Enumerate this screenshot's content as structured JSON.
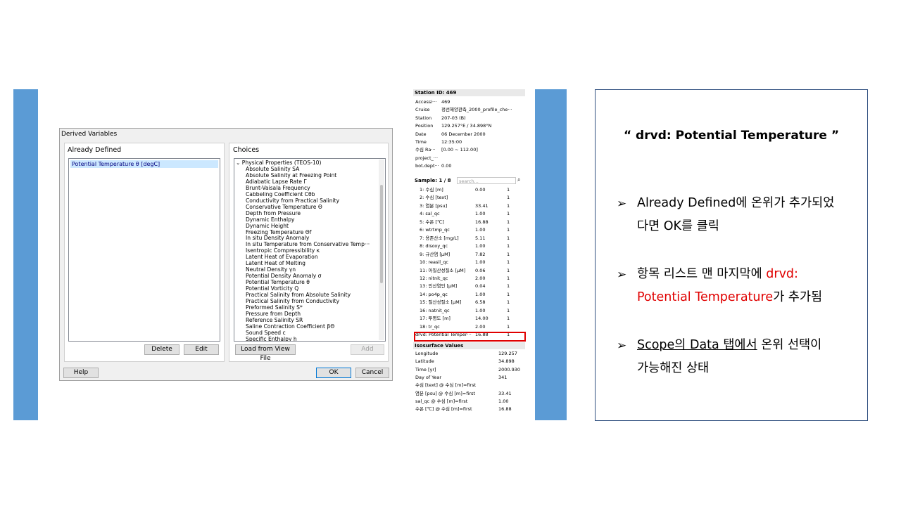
{
  "dialog": {
    "title": "Derived Variables",
    "already_defined_label": "Already Defined",
    "choices_label": "Choices",
    "defined_item": "Potential Temperature θ [degC]",
    "tree_root": "Physical Properties (TEOS-10)",
    "choices": [
      "Absolute Salinity SA",
      "Absolute Salinity at Freezing Point",
      "Adiabatic Lapse Rate Γ",
      "Brunt-Vaisala Frequency",
      "Cabbeling Coefficient Cθb",
      "Conductivity from Practical Salinity",
      "Conservative Temperature Θ",
      "Depth from Pressure",
      "Dynamic Enthalpy",
      "Dynamic Height",
      "Freezing Temperature Θf",
      "In situ Density Anomaly",
      "In situ Temperature from Conservative Temp···",
      "Isentropic Compressibility κ",
      "Latent Heat of Evaporation",
      "Latent Heat of Melting",
      "Neutral Density γn",
      "Potential Density Anomaly σ",
      "Potential Temperature θ",
      "Potential Vorticity Q",
      "Practical Salinity from Absolute Salinity",
      "Practical Salinity from Conductivity",
      "Preformed Salinity S*",
      "Pressure from Depth",
      "Reference Salinity SR",
      "Saline Contraction Coefficient βΘ",
      "Sound Speed c",
      "Specific Enthalpy h"
    ],
    "buttons": {
      "delete": "Delete",
      "edit": "Edit",
      "load": "Load from View File",
      "add": "Add",
      "help": "Help",
      "ok": "OK",
      "cancel": "Cancel"
    }
  },
  "station": {
    "header": "Station ID: 469",
    "rows": [
      {
        "k": "Accessi···",
        "v": "469"
      },
      {
        "k": "Cruise",
        "v": "정선해양관측_2000_profile_che···"
      },
      {
        "k": "Station",
        "v": "207-03 (B)"
      },
      {
        "k": "Position",
        "v": "129.257°E / 34.898°N"
      },
      {
        "k": "Date",
        "v": "06 December 2000"
      },
      {
        "k": "Time",
        "v": "12:35:00"
      },
      {
        "k": "수심 Ra···",
        "v": "[0.00 ~ 112.00]"
      },
      {
        "k": "project_···",
        "v": ""
      },
      {
        "k": "bot.dept···",
        "v": "0.00"
      }
    ]
  },
  "sample": {
    "header": "Sample: 1 / 8",
    "search_placeholder": "search...",
    "rows": [
      {
        "k": "1: 수심 [m]",
        "v": "0.00",
        "f": "1"
      },
      {
        "k": "2: 수심 [text]",
        "v": "",
        "f": "1"
      },
      {
        "k": "3: 염분 [psu]",
        "v": "33.41",
        "f": "1"
      },
      {
        "k": "4: sal_qc",
        "v": "1.00",
        "f": "1"
      },
      {
        "k": "5: 수온 [℃]",
        "v": "16.88",
        "f": "1"
      },
      {
        "k": "6: wtrtmp_qc",
        "v": "1.00",
        "f": "1"
      },
      {
        "k": "7: 용존산소 [mg/L]",
        "v": "5.11",
        "f": "1"
      },
      {
        "k": "8: disoxy_qc",
        "v": "1.00",
        "f": "1"
      },
      {
        "k": "9: 규산염 [μM]",
        "v": "7.82",
        "f": "1"
      },
      {
        "k": "10: reasil_qc",
        "v": "1.00",
        "f": "1"
      },
      {
        "k": "11: 아질산성질소 [μM]",
        "v": "0.06",
        "f": "1"
      },
      {
        "k": "12: nitnit_qc",
        "v": "2.00",
        "f": "1"
      },
      {
        "k": "13: 인산염인 [μM]",
        "v": "0.04",
        "f": "1"
      },
      {
        "k": "14: po4p_qc",
        "v": "1.00",
        "f": "1"
      },
      {
        "k": "15: 질산성질소 [μM]",
        "v": "6.58",
        "f": "1"
      },
      {
        "k": "16: natnit_qc",
        "v": "1.00",
        "f": "1"
      },
      {
        "k": "17: 투명도 [m]",
        "v": "14.00",
        "f": "1"
      },
      {
        "k": "18: tr_qc",
        "v": "2.00",
        "f": "1"
      },
      {
        "k": "drvd: Potential Temper···",
        "v": "16.88",
        "f": "1"
      }
    ]
  },
  "isosurface": {
    "header": "Isosurface Values",
    "rows": [
      {
        "k": "Longitude",
        "v": "129.257"
      },
      {
        "k": "Latitude",
        "v": "34.898"
      },
      {
        "k": "Time [yr]",
        "v": "2000.930"
      },
      {
        "k": "Day of Year",
        "v": "341"
      },
      {
        "k": "수심 [text] @ 수심 [m]=first",
        "v": ""
      },
      {
        "k": "염분 [psu] @ 수심 [m]=first",
        "v": "33.41"
      },
      {
        "k": "sal_qc @ 수심 [m]=first",
        "v": "1.00"
      },
      {
        "k": "수온 [℃] @ 수심 [m]=first",
        "v": "16.88"
      }
    ]
  },
  "notes": {
    "heading": "“ drvd: Potential Temperature ”",
    "bullet": "➢",
    "b1_line1": "Already Defined에 온위가 추가되었",
    "b1_line2": "다면 OK를 클릭",
    "b2_a": "항목 리스트 맨 마지막에 ",
    "b2_red1": "drvd:",
    "b2_red2": "Potential Temperature",
    "b2_b": "가 추가됨",
    "b3_u": "Scope의 Data 탭에서",
    "b3_rest": " 온위 선택이",
    "b3_line2": "가능해진 상태"
  },
  "colors": {
    "accent_bar": "#5b9bd5",
    "highlight": "#e00000"
  }
}
